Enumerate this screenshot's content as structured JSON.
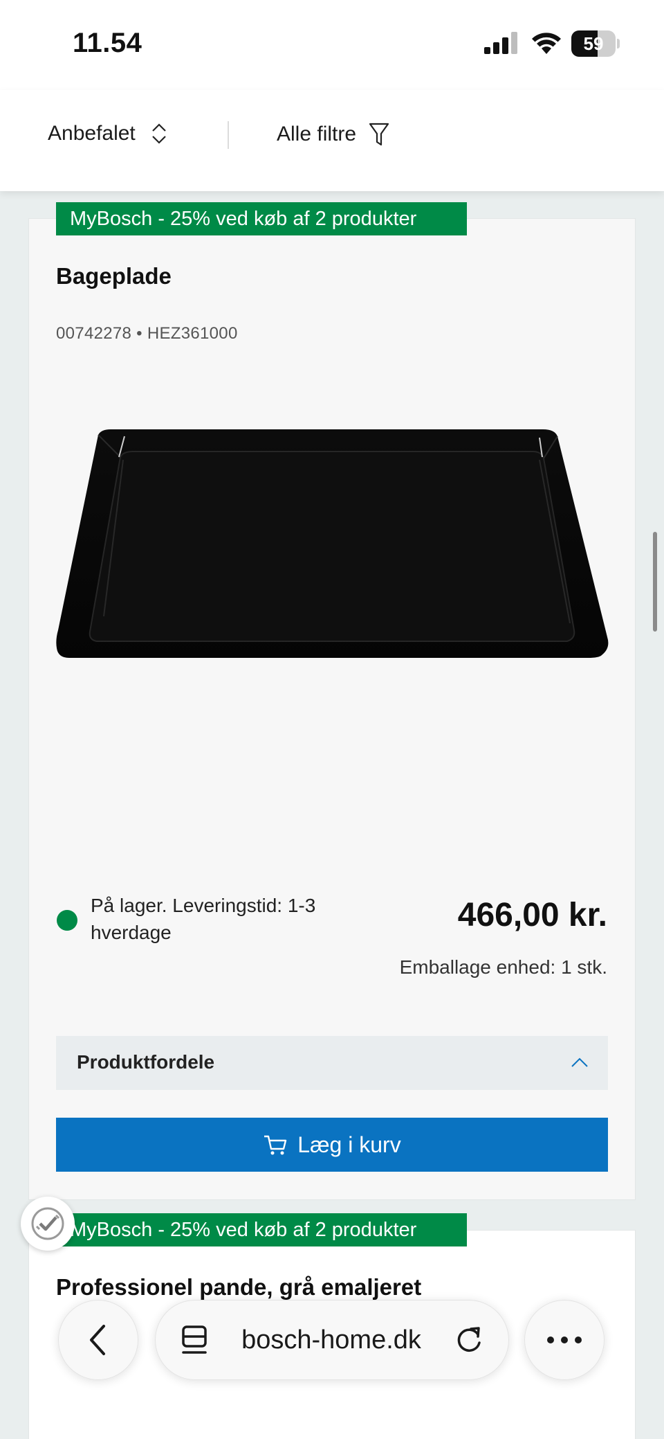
{
  "status_bar": {
    "time": "11.54",
    "battery": "59",
    "battery_level": 0.59
  },
  "toolbar": {
    "sort_label": "Anbefalet",
    "filter_label": "Alle filtre"
  },
  "products": [
    {
      "promo": "MyBosch - 25% ved køb af 2 produkter",
      "title": "Bageplade",
      "sku": "00742278 • HEZ361000",
      "stock": "På lager. Leveringstid: 1-3 hverdage",
      "price": "466,00 kr.",
      "packaging": "Emballage enhed: 1 stk.",
      "accordion_label": "Produktfordele",
      "cart_label": "Læg i kurv"
    },
    {
      "promo": "MyBosch - 25% ved køb af 2 produkter",
      "title": "Professionel pande, grå emaljeret"
    }
  ],
  "browser": {
    "url": "bosch-home.dk"
  },
  "colors": {
    "promo_green": "#008a47",
    "button_blue": "#0a73c1",
    "stock_green": "#008a47"
  }
}
